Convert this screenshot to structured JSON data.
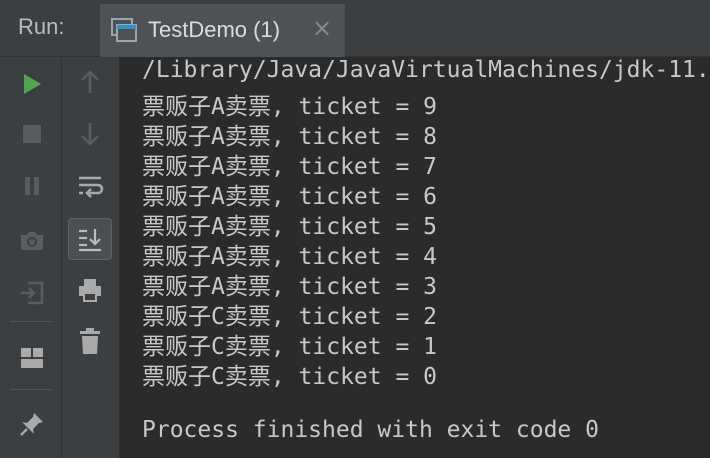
{
  "header": {
    "run_label": "Run:",
    "tab": {
      "title": "TestDemo (1)",
      "close": "×"
    }
  },
  "toolbar": {
    "left": [
      {
        "name": "run-icon"
      },
      {
        "name": "stop-icon"
      },
      {
        "name": "pause-icon"
      },
      {
        "name": "camera-icon"
      },
      {
        "name": "exit-icon"
      },
      {
        "name": "layout-icon"
      },
      {
        "name": "pin-icon"
      }
    ],
    "right": [
      {
        "name": "arrow-up-icon"
      },
      {
        "name": "arrow-down-icon"
      },
      {
        "name": "soft-wrap-icon"
      },
      {
        "name": "scroll-to-end-icon"
      },
      {
        "name": "print-icon"
      },
      {
        "name": "trash-icon"
      }
    ]
  },
  "console": {
    "lines": [
      "/Library/Java/JavaVirtualMachines/jdk-11.",
      "票贩子A卖票, ticket = 9",
      "票贩子A卖票, ticket = 8",
      "票贩子A卖票, ticket = 7",
      "票贩子A卖票, ticket = 6",
      "票贩子A卖票, ticket = 5",
      "票贩子A卖票, ticket = 4",
      "票贩子A卖票, ticket = 3",
      "票贩子C卖票, ticket = 2",
      "票贩子C卖票, ticket = 1",
      "票贩子C卖票, ticket = 0",
      "",
      "Process finished with exit code 0"
    ]
  },
  "colors": {
    "accent_green": "#4fa64f",
    "background": "#2b2b2b",
    "panel": "#3c3f41",
    "text": "#c8c8c8"
  }
}
